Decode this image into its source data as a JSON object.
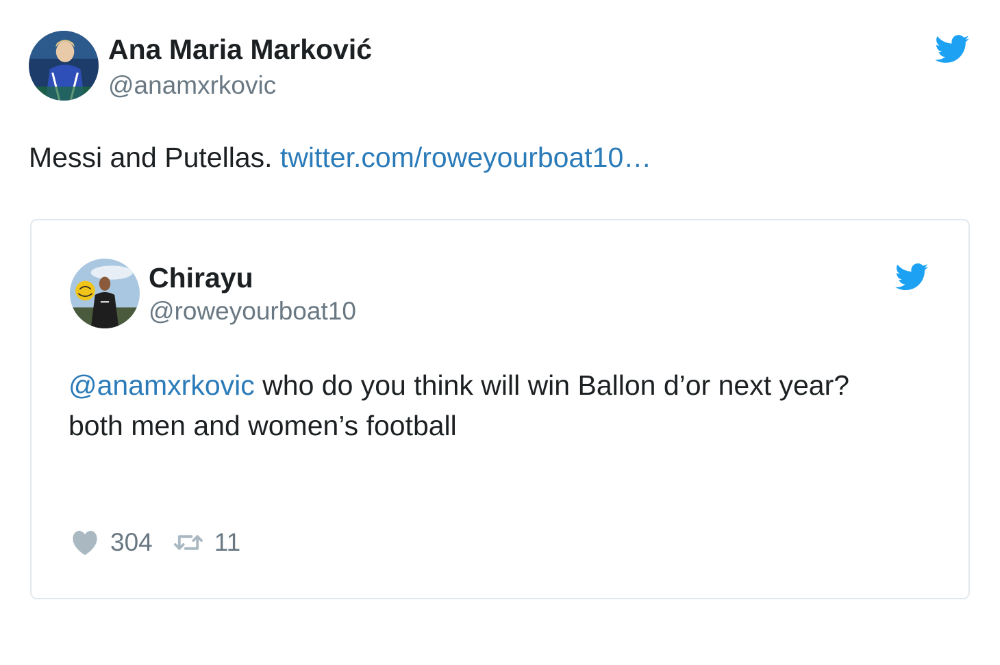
{
  "tweet": {
    "author": {
      "name": "Ana Maria Marković",
      "handle": "@anamxrkovic",
      "avatar_icon": "avatar-ana"
    },
    "brand_icon": "twitter-bird-icon",
    "text": "Messi and Putellas.",
    "link_text": "twitter.com/roweyourboat10…"
  },
  "quoted_tweet": {
    "author": {
      "name": "Chirayu",
      "handle": "@roweyourboat10",
      "avatar_icon": "avatar-chirayu"
    },
    "brand_icon": "twitter-bird-icon",
    "mention": "@anamxrkovic",
    "text_line1": "who do you think will win Ballon d’or next year?",
    "text_line2": "both men and women’s football",
    "likes": "304",
    "retweets": "11"
  },
  "colors": {
    "twitter_blue": "#1da1f2",
    "link": "#2b7bb9",
    "muted": "#697882",
    "text": "#1c2022",
    "border": "#e1e8ed"
  }
}
